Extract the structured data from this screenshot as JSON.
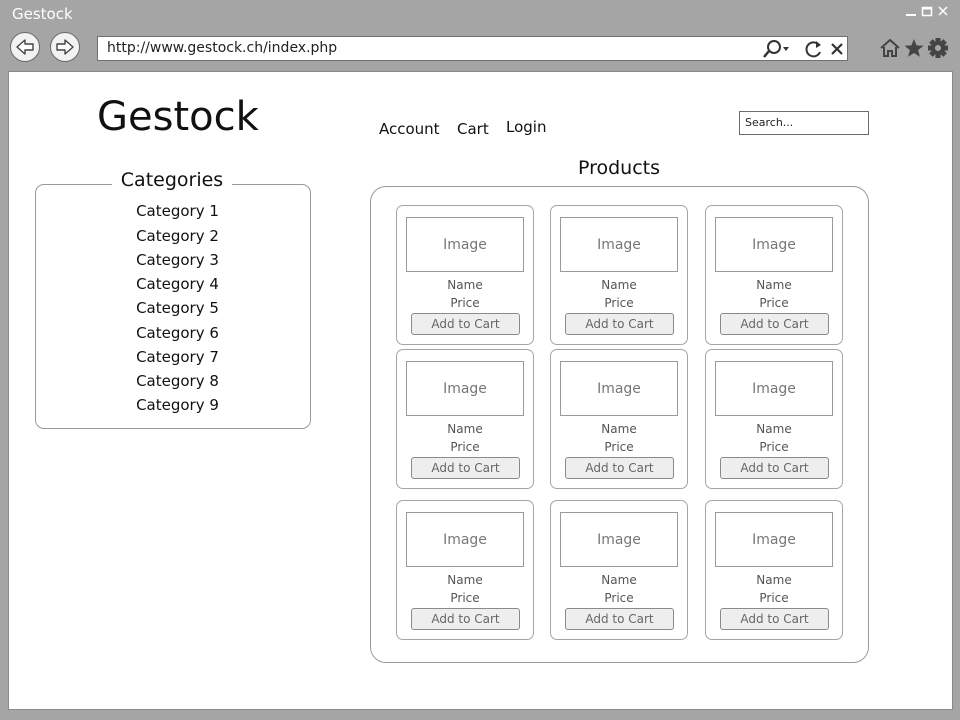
{
  "window": {
    "title": "Gestock"
  },
  "browser": {
    "url": "http://www.gestock.ch/index.php"
  },
  "site": {
    "logo": "Gestock",
    "nav": [
      "Account",
      "Cart",
      "Login"
    ],
    "search_placeholder": "Search..."
  },
  "categories": {
    "title": "Categories",
    "items": [
      "Category 1",
      "Category 2",
      "Category 3",
      "Category 4",
      "Category 5",
      "Category 6",
      "Category 7",
      "Category 8",
      "Category 9"
    ]
  },
  "products": {
    "title": "Products",
    "items": [
      {
        "image": "Image",
        "name": "Name",
        "price": "Price",
        "button": "Add to Cart"
      },
      {
        "image": "Image",
        "name": "Name",
        "price": "Price",
        "button": "Add to Cart"
      },
      {
        "image": "Image",
        "name": "Name",
        "price": "Price",
        "button": "Add to Cart"
      },
      {
        "image": "Image",
        "name": "Name",
        "price": "Price",
        "button": "Add to Cart"
      },
      {
        "image": "Image",
        "name": "Name",
        "price": "Price",
        "button": "Add to Cart"
      },
      {
        "image": "Image",
        "name": "Name",
        "price": "Price",
        "button": "Add to Cart"
      },
      {
        "image": "Image",
        "name": "Name",
        "price": "Price",
        "button": "Add to Cart"
      },
      {
        "image": "Image",
        "name": "Name",
        "price": "Price",
        "button": "Add to Cart"
      },
      {
        "image": "Image",
        "name": "Name",
        "price": "Price",
        "button": "Add to Cart"
      }
    ]
  },
  "icons": [
    "back-icon",
    "forward-icon",
    "search-icon",
    "refresh-icon",
    "close-icon",
    "home-icon",
    "star-icon",
    "gear-icon",
    "minimize-icon",
    "maximize-icon",
    "window-close-icon"
  ]
}
